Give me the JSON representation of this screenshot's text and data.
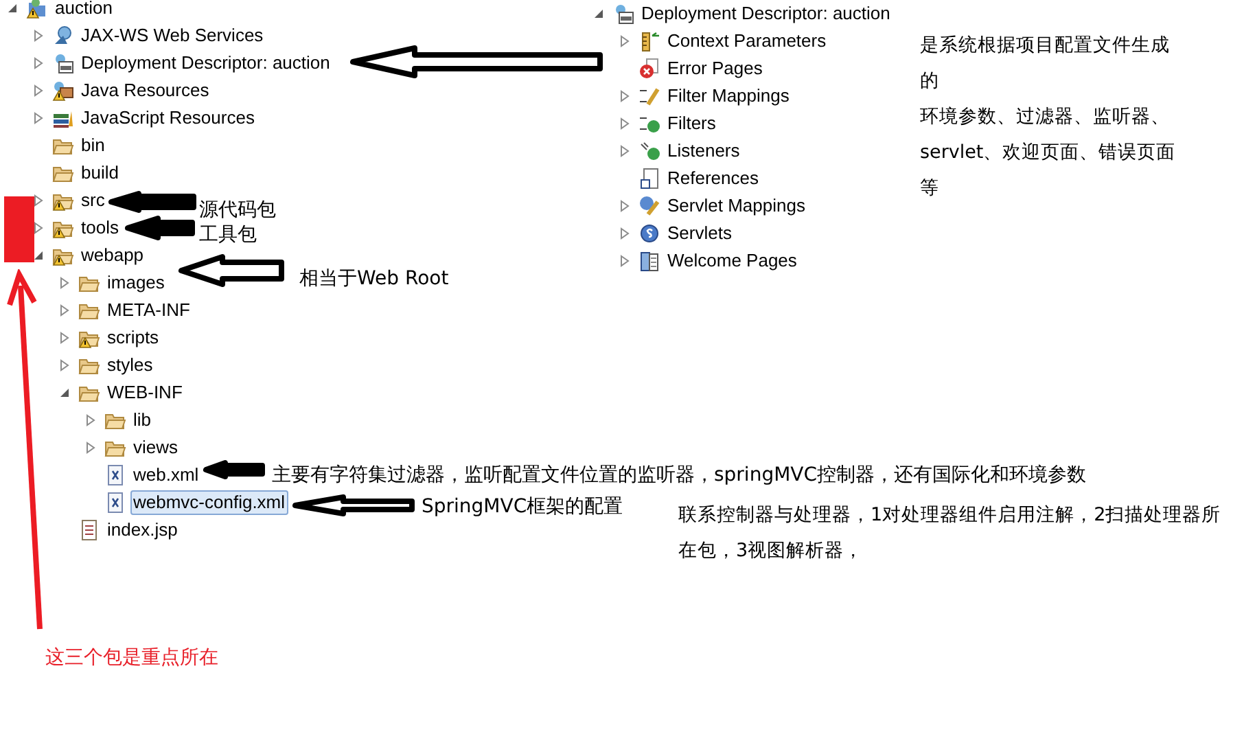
{
  "project_tree": {
    "label": "auction",
    "kind": "project",
    "expanded": true,
    "warning": true,
    "selected": false,
    "children": [
      {
        "label": "JAX-WS Web Services",
        "kind": "web-services",
        "expanded": false,
        "warning": false,
        "selected": false
      },
      {
        "label": "Deployment Descriptor: auction",
        "kind": "descriptor",
        "expanded": false,
        "warning": false,
        "selected": false
      },
      {
        "label": "Java Resources",
        "kind": "java-resources",
        "expanded": false,
        "warning": true,
        "selected": false
      },
      {
        "label": "JavaScript Resources",
        "kind": "js-resources",
        "expanded": false,
        "warning": false,
        "selected": false
      },
      {
        "label": "bin",
        "kind": "folder",
        "warning": false,
        "selected": false
      },
      {
        "label": "build",
        "kind": "folder",
        "warning": false,
        "selected": false
      },
      {
        "label": "src",
        "kind": "folder",
        "expanded": false,
        "warning": true,
        "selected": false
      },
      {
        "label": "tools",
        "kind": "folder",
        "expanded": false,
        "warning": true,
        "selected": false
      },
      {
        "label": "webapp",
        "kind": "folder",
        "expanded": true,
        "warning": true,
        "selected": false,
        "children": [
          {
            "label": "images",
            "kind": "folder",
            "expanded": false,
            "warning": false,
            "selected": false
          },
          {
            "label": "META-INF",
            "kind": "folder",
            "expanded": false,
            "warning": false,
            "selected": false
          },
          {
            "label": "scripts",
            "kind": "folder",
            "expanded": false,
            "warning": true,
            "selected": false
          },
          {
            "label": "styles",
            "kind": "folder",
            "expanded": false,
            "warning": false,
            "selected": false
          },
          {
            "label": "WEB-INF",
            "kind": "folder",
            "expanded": true,
            "warning": false,
            "selected": false,
            "children": [
              {
                "label": "lib",
                "kind": "folder",
                "expanded": false,
                "warning": false,
                "selected": false
              },
              {
                "label": "views",
                "kind": "folder",
                "expanded": false,
                "warning": false,
                "selected": false
              },
              {
                "label": "web.xml",
                "kind": "xml",
                "warning": false,
                "selected": false
              },
              {
                "label": "webmvc-config.xml",
                "kind": "xml",
                "warning": false,
                "selected": true
              }
            ]
          },
          {
            "label": "index.jsp",
            "kind": "jsp",
            "warning": false,
            "selected": false
          }
        ]
      }
    ]
  },
  "descriptor_tree": {
    "label": "Deployment Descriptor: auction",
    "kind": "descriptor",
    "expanded": true,
    "warning": false,
    "selected": false,
    "children": [
      {
        "label": "Context Parameters",
        "kind": "context-params",
        "expanded": false,
        "warning": false,
        "selected": false
      },
      {
        "label": "Error Pages",
        "kind": "error-pages",
        "warning": false,
        "selected": false
      },
      {
        "label": "Filter Mappings",
        "kind": "filter-mappings",
        "expanded": false,
        "warning": false,
        "selected": false
      },
      {
        "label": "Filters",
        "kind": "filters",
        "expanded": false,
        "warning": false,
        "selected": false
      },
      {
        "label": "Listeners",
        "kind": "listeners",
        "expanded": false,
        "warning": false,
        "selected": false
      },
      {
        "label": "References",
        "kind": "references",
        "warning": false,
        "selected": false
      },
      {
        "label": "Servlet Mappings",
        "kind": "servlet-mappings",
        "expanded": false,
        "warning": false,
        "selected": false
      },
      {
        "label": "Servlets",
        "kind": "servlets",
        "expanded": false,
        "warning": false,
        "selected": false
      },
      {
        "label": "Welcome Pages",
        "kind": "welcome-pages",
        "expanded": false,
        "warning": false,
        "selected": false
      }
    ]
  },
  "notes": [
    {
      "paragraphs": [
        "是系统根据项目配置文件生成的",
        "环境参数、过滤器、监听器、servlet、欢迎页面、错误页面等"
      ],
      "color": "#000000"
    },
    {
      "paragraphs": [
        "源代码包"
      ],
      "color": "#000000"
    },
    {
      "paragraphs": [
        "工具包"
      ],
      "color": "#000000"
    },
    {
      "paragraphs": [
        "相当于Web Root"
      ],
      "color": "#000000"
    },
    {
      "paragraphs": [
        "主要有字符集过滤器，监听配置文件位置的监听器，springMVC控制器，还有国际化和环境参数"
      ],
      "color": "#000000"
    },
    {
      "paragraphs": [
        "SpringMVC框架的配置"
      ],
      "color": "#000000"
    },
    {
      "paragraphs": [
        "联系控制器与处理器，1对处理器组件启用注解，2扫描处理器所在包，3视图解析器，"
      ],
      "color": "#000000"
    },
    {
      "paragraphs": [
        "这三个包是重点所在"
      ],
      "color": "#e8202a"
    }
  ]
}
